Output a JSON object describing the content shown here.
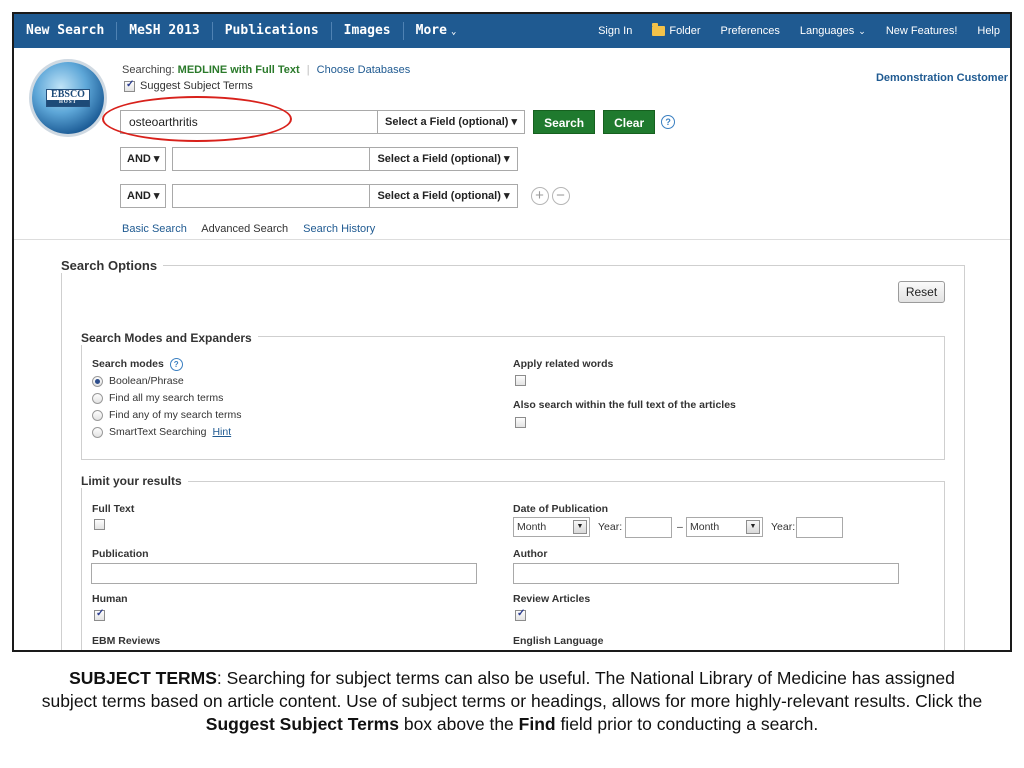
{
  "topnav": {
    "items": [
      "New Search",
      "MeSH 2013",
      "Publications",
      "Images",
      "More"
    ],
    "more_caret": "⌄",
    "right_items": {
      "sign_in": "Sign In",
      "folder": "Folder",
      "preferences": "Preferences",
      "languages": "Languages",
      "new_features": "New Features!",
      "help": "Help"
    }
  },
  "logo": {
    "top": "EBSCO",
    "bottom": "HOST"
  },
  "search": {
    "searching_label": "Searching:",
    "database": "MEDLINE with Full Text",
    "choose_databases": "Choose Databases",
    "suggest_subject_terms": "Suggest Subject Terms",
    "suggest_checked": true,
    "rows": [
      {
        "bool": "",
        "term": "osteoarthritis",
        "field": "Select a Field (optional)"
      },
      {
        "bool": "AND",
        "term": "",
        "field": "Select a Field (optional)"
      },
      {
        "bool": "AND",
        "term": "",
        "field": "Select a Field (optional)"
      }
    ],
    "search_button": "Search",
    "clear_button": "Clear",
    "help_glyph": "?",
    "add_glyph": "+",
    "remove_glyph": "−",
    "links": [
      "Basic Search",
      "Advanced Search",
      "Search History"
    ],
    "current_link": "Advanced Search"
  },
  "account": {
    "name": "Demonstration Customer"
  },
  "options": {
    "title": "Search Options",
    "reset": "Reset",
    "modes_group": {
      "title": "Search Modes and Expanders",
      "modes_label": "Search modes",
      "modes": [
        "Boolean/Phrase",
        "Find all my search terms",
        "Find any of my search terms",
        "SmartText Searching"
      ],
      "selected_mode": "Boolean/Phrase",
      "hint": "Hint",
      "apply_related": "Apply related words",
      "also_fulltext": "Also search within the full text of the articles"
    },
    "limits_group": {
      "title": "Limit your results",
      "full_text": "Full Text",
      "date_of_publication": "Date of Publication",
      "month_1": "Month",
      "year_1": "Year:",
      "dash": "–",
      "month_2": "Month",
      "year_2": "Year:",
      "publication": "Publication",
      "author": "Author",
      "human": "Human",
      "review_articles": "Review Articles",
      "ebm_reviews": "EBM Reviews",
      "english_language": "English Language"
    }
  },
  "caption": {
    "lead": "SUBJECT TERMS",
    "p1": ":  Searching for subject terms can also be useful. The National Library of Medicine has assigned subject terms based on article content. Use of subject terms or headings, allows for more highly-relevant results. Click the ",
    "bold1": "Suggest Subject Terms",
    "p2": " box above the ",
    "bold2": "Find",
    "p3": " field prior to conducting a search."
  },
  "colors": {
    "nav_blue": "#1f5a91",
    "green_button": "#1f7a2e",
    "annotation_red": "#d8211b",
    "link_blue": "#1f5a91"
  }
}
